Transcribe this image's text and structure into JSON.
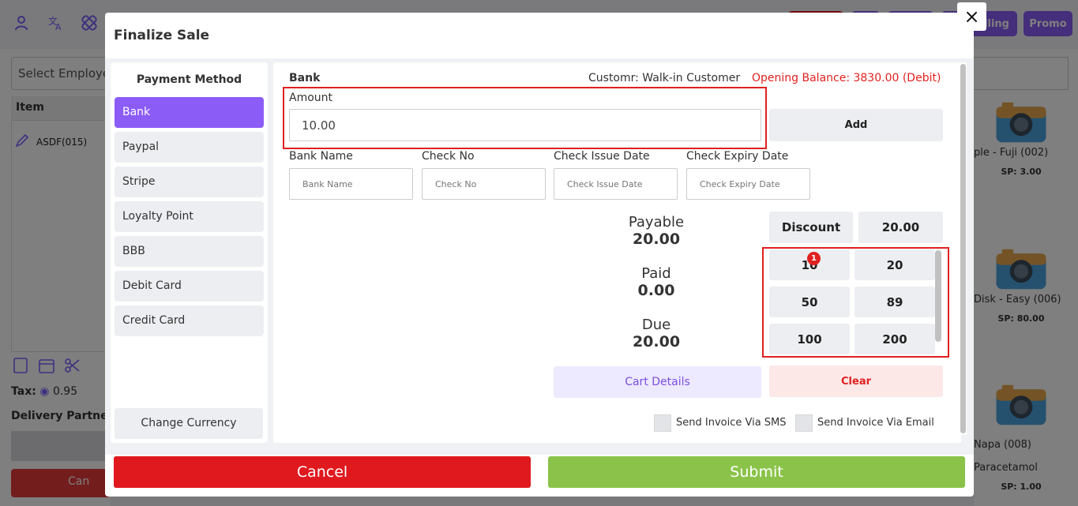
{
  "background": {
    "employee_select": "Select Employee",
    "item_header": "Item",
    "item_row": "ASDF(015)",
    "tax_label": "Tax:",
    "tax_value": "0.95",
    "delivery_label": "Delivery Partner:",
    "cancel_label": "Can",
    "selling_label": "lling",
    "promo_label": "Promo",
    "products": [
      {
        "name": "ple - Fuji (002)",
        "sp": "SP: 3.00"
      },
      {
        "name": "Disk - Easy (006)",
        "sp": "SP: 80.00"
      },
      {
        "name": "Napa (008)",
        "sp": ""
      },
      {
        "name": "Paracetamol",
        "sp": "SP: 1.00"
      }
    ]
  },
  "modal": {
    "title": "Finalize Sale",
    "close": "×"
  },
  "payment_methods": {
    "title": "Payment Method",
    "items": [
      "Bank",
      "Paypal",
      "Stripe",
      "Loyalty Point",
      "BBB",
      "Debit Card",
      "Credit Card"
    ],
    "active": "Bank",
    "change_currency": "Change Currency"
  },
  "payment": {
    "method_title": "Bank",
    "customer": "Customr: Walk-in Customer",
    "opening_balance": "Opening Balance: 3830.00 (Debit)",
    "amount_label": "Amount",
    "amount_value": "10.00",
    "add_label": "Add",
    "fields": [
      {
        "label": "Bank Name",
        "placeholder": "Bank Name"
      },
      {
        "label": "Check No",
        "placeholder": "Check No"
      },
      {
        "label": "Check Issue Date",
        "placeholder": "Check Issue Date"
      },
      {
        "label": "Check Expiry Date",
        "placeholder": "Check Expiry Date"
      }
    ]
  },
  "summary": {
    "payable_label": "Payable",
    "payable_value": "20.00",
    "paid_label": "Paid",
    "paid_value": "0.00",
    "due_label": "Due",
    "due_value": "20.00"
  },
  "discount": {
    "label": "Discount",
    "value": "20.00"
  },
  "quick_amounts": {
    "values": [
      "10",
      "20",
      "50",
      "89",
      "100",
      "200"
    ],
    "badge": "1"
  },
  "actions": {
    "cart_details": "Cart Details",
    "clear": "Clear",
    "send_sms": "Send Invoice Via SMS",
    "send_email": "Send Invoice Via Email",
    "cancel": "Cancel",
    "submit": "Submit"
  },
  "colors": {
    "accent": "#8b5cf6",
    "danger": "#e0191f",
    "success": "#8bc34a"
  }
}
